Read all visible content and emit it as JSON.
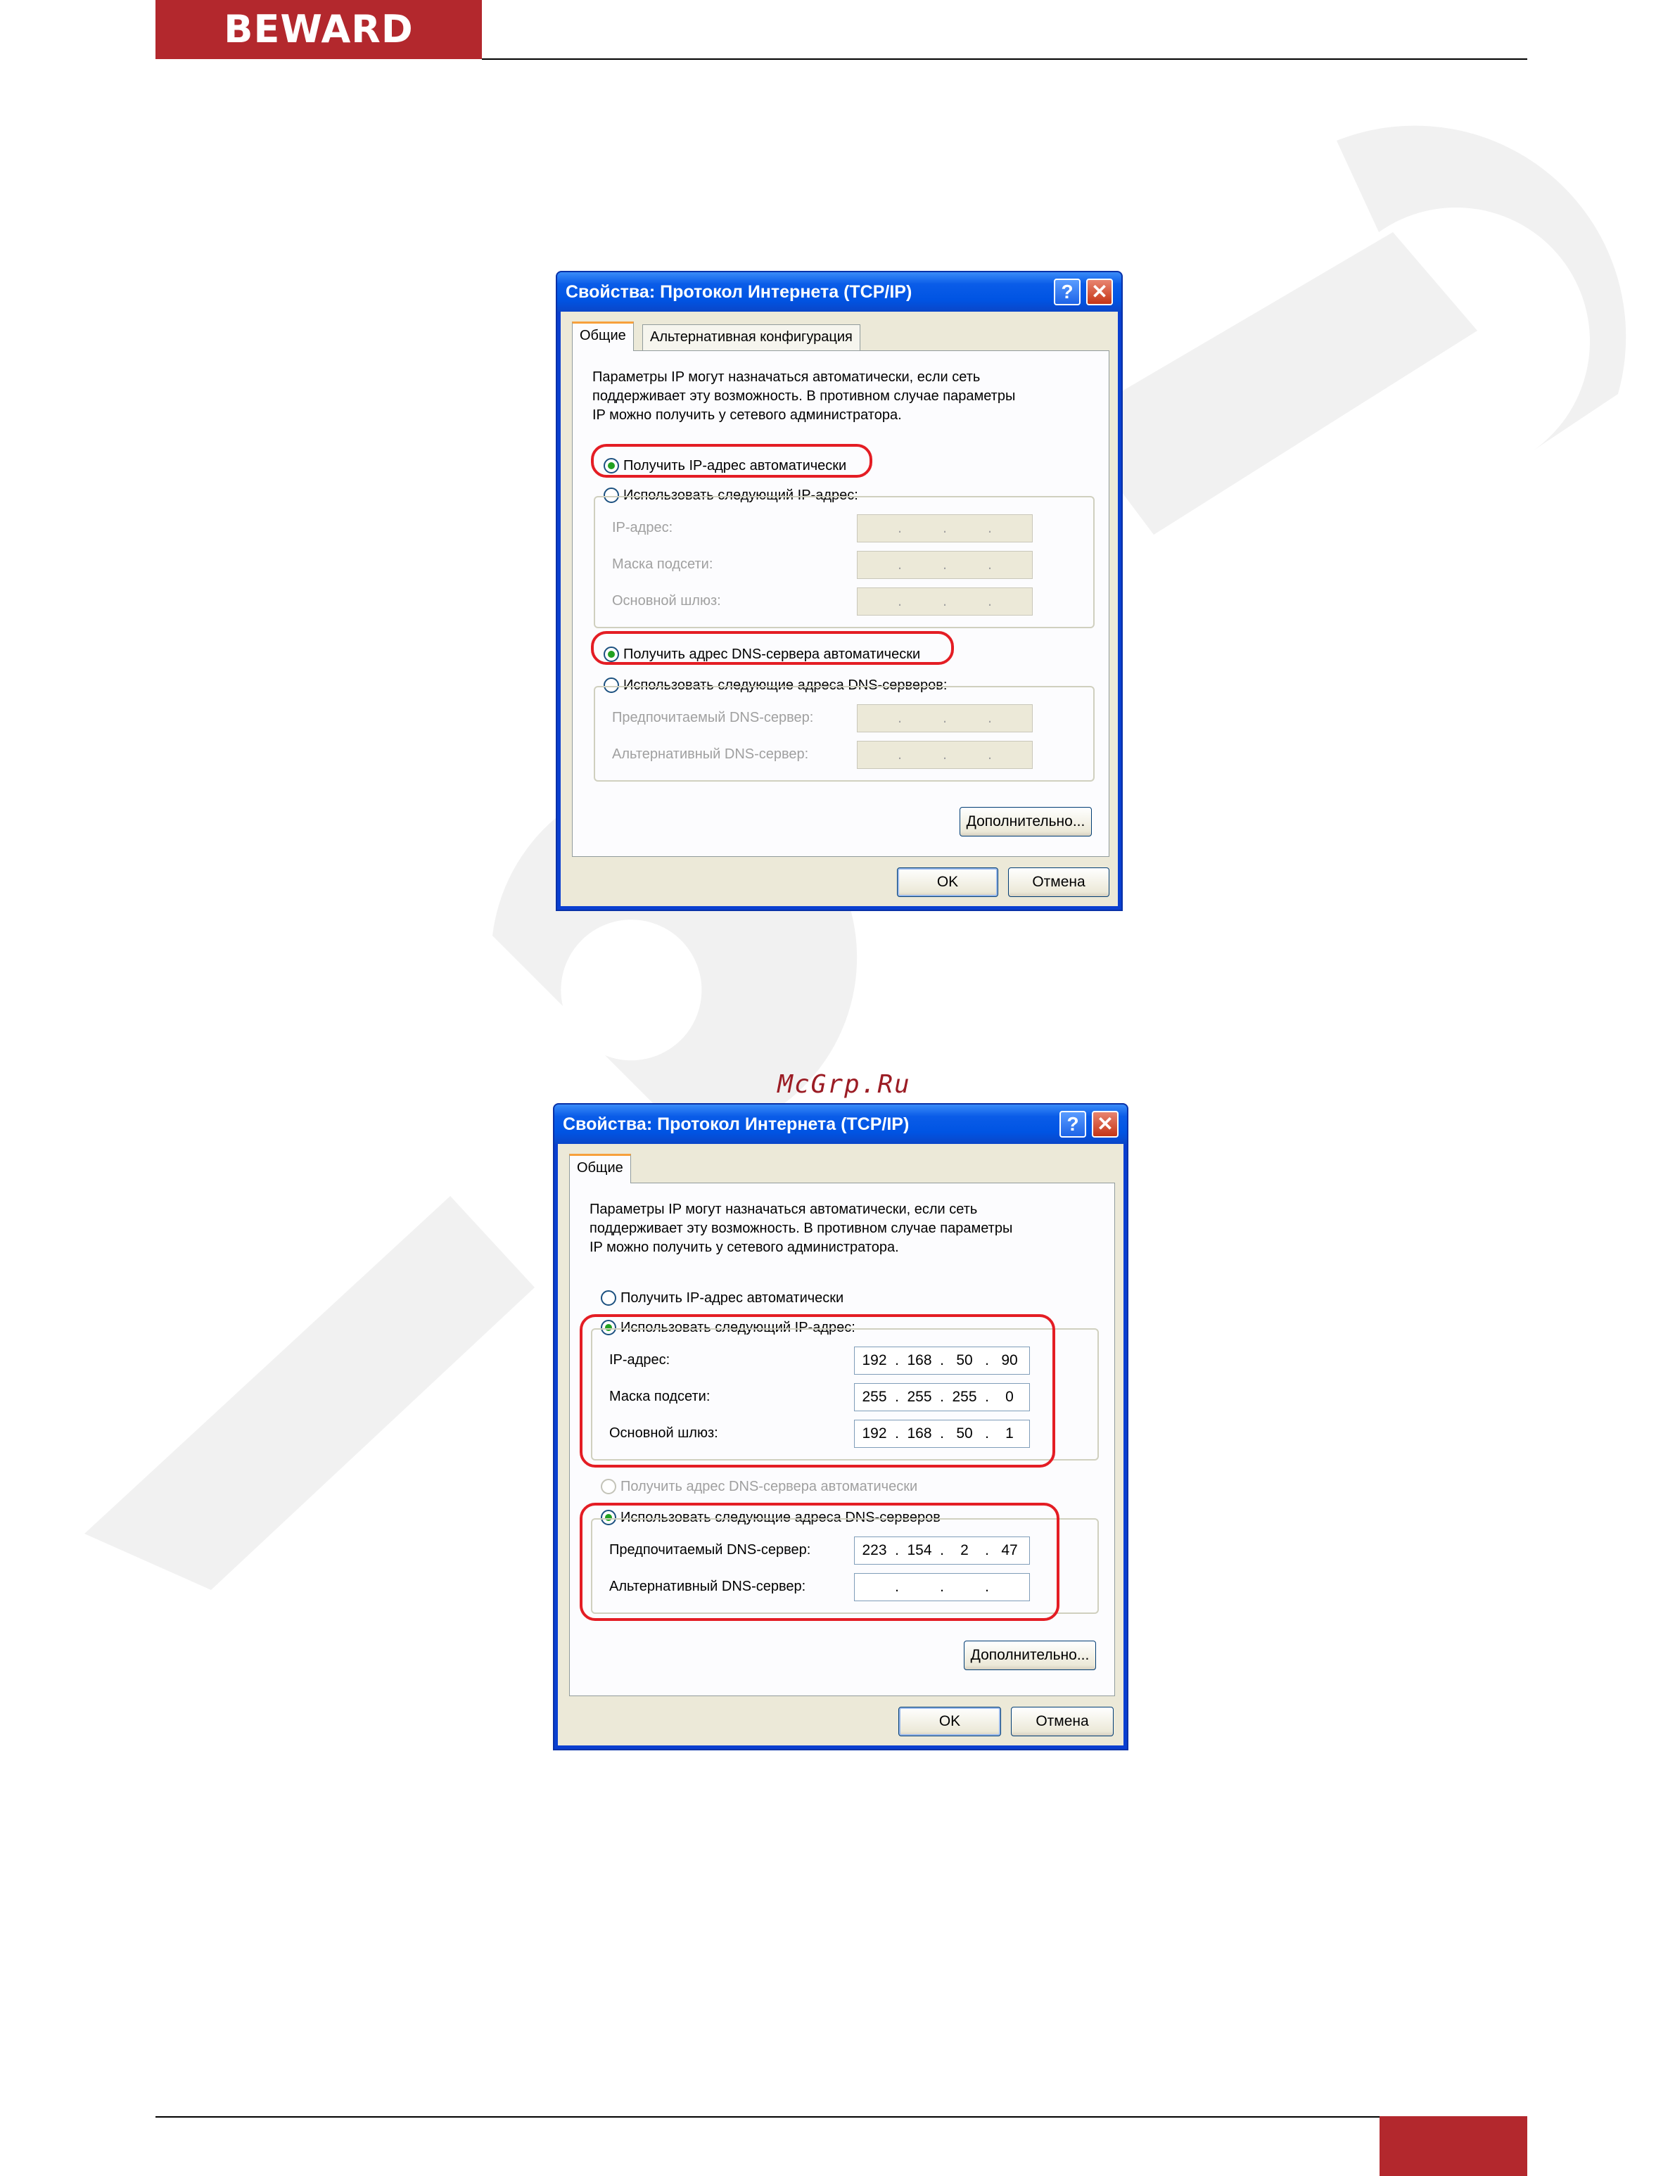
{
  "header": {
    "logo": "BEWARD"
  },
  "watermark_site": "McGrp.Ru",
  "dialogs": [
    {
      "title": "Свойства: Протокол Интернета (TCP/IP)",
      "help_glyph": "?",
      "close_glyph": "✕",
      "tabs": [
        "Общие",
        "Альтернативная конфигурация"
      ],
      "intro": "Параметры IP могут назначаться автоматически, если сеть\nподдерживает эту возможность. В противном случае параметры\nIP можно получить у сетевого администратора.",
      "radio_ip_auto": "Получить IP-адрес автоматически",
      "radio_ip_manual": "Использовать следующий IP-адрес:",
      "labels": [
        "IP-адрес:",
        "Маска подсети:",
        "Основной шлюз:"
      ],
      "radio_dns_auto": "Получить адрес DNS-сервера автоматически",
      "radio_dns_manual": "Использовать следующие адреса DNS-серверов:",
      "dns_labels": [
        "Предпочитаемый DNS-сервер:",
        "Альтернативный DNS-сервер:"
      ],
      "advanced_btn": "Дополнительно...",
      "ok_btn": "OK",
      "cancel_btn": "Отмена"
    },
    {
      "title": "Свойства: Протокол Интернета (TCP/IP)",
      "help_glyph": "?",
      "close_glyph": "✕",
      "tabs": [
        "Общие"
      ],
      "intro": "Параметры IP могут назначаться автоматически, если сеть\nподдерживает эту возможность. В противном случае параметры\nIP можно получить у сетевого администратора.",
      "radio_ip_auto": "Получить IP-адрес автоматически",
      "radio_ip_manual": "Использовать следующий IP-адрес:",
      "labels": [
        "IP-адрес:",
        "Маска подсети:",
        "Основной шлюз:"
      ],
      "ip_values": [
        [
          "192",
          "168",
          "50",
          "90"
        ],
        [
          "255",
          "255",
          "255",
          "0"
        ],
        [
          "192",
          "168",
          "50",
          "1"
        ]
      ],
      "radio_dns_auto": "Получить адрес DNS-сервера автоматически",
      "radio_dns_manual": "Использовать следующие адреса DNS-серверов",
      "dns_labels": [
        "Предпочитаемый DNS-сервер:",
        "Альтернативный DNS-сервер:"
      ],
      "dns_values": [
        [
          "223",
          "154",
          "2",
          "47"
        ],
        [
          "",
          "",
          "",
          ""
        ]
      ],
      "advanced_btn": "Дополнительно...",
      "ok_btn": "OK",
      "cancel_btn": "Отмена"
    }
  ],
  "colors": {
    "brand": "#b3282d",
    "xp_title": "#0054e3",
    "highlight": "#e41d24",
    "selected_radio": "#21a121"
  }
}
